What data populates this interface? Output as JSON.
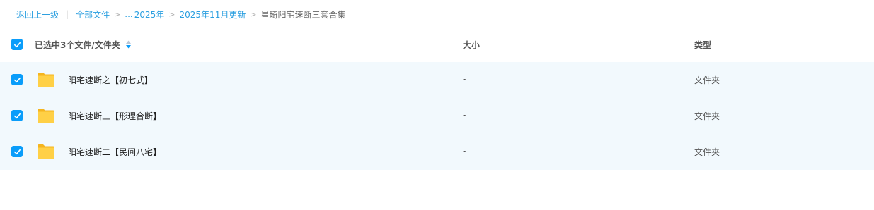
{
  "breadcrumb": {
    "back": "返回上一级",
    "divider": "|",
    "root": "全部文件",
    "ellipsis": "...",
    "items": [
      "2025年",
      "2025年11月更新"
    ],
    "current": "星琦阳宅速断三套合集",
    "separator": ">"
  },
  "header": {
    "selection_label": "已选中3个文件/文件夹",
    "size_label": "大小",
    "type_label": "类型"
  },
  "files": [
    {
      "name": "阳宅速断之【初七式】",
      "size": "-",
      "type": "文件夹"
    },
    {
      "name": "阳宅速断三【形理合断】",
      "size": "-",
      "type": "文件夹"
    },
    {
      "name": "阳宅速断二【民间八宅】",
      "size": "-",
      "type": "文件夹"
    }
  ],
  "colors": {
    "accent": "#0a9dfa",
    "link": "#2b9fe0",
    "row_selected_bg": "#f2f9fd",
    "folder": "#ffc93c"
  },
  "icons": {
    "checkbox": "checkbox-checked-icon",
    "sort": "sort-icon",
    "folder": "folder-icon"
  }
}
